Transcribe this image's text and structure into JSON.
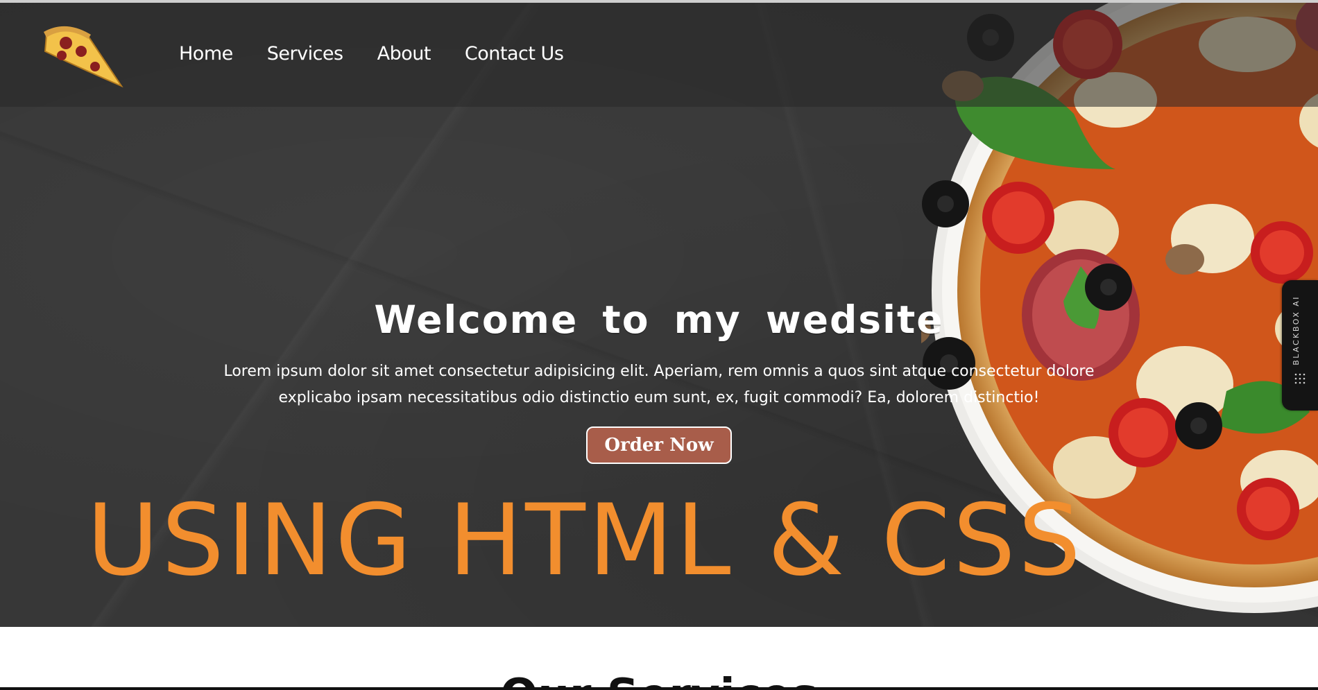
{
  "nav": {
    "items": [
      {
        "label": "Home"
      },
      {
        "label": "Services"
      },
      {
        "label": "About"
      },
      {
        "label": "Contact Us"
      }
    ]
  },
  "hero": {
    "title": "Welcome to my wedsite",
    "text": "Lorem ipsum dolor sit amet consectetur adipisicing elit. Aperiam, rem omnis a quos sint atque consectetur dolore explicabo ipsam necessitatibus odio distinctio eum sunt, ex, fugit commodi? Ea, dolorem distinctio!",
    "button": "Order Now",
    "banner": "USING HTML & CSS"
  },
  "sidebar_widget": {
    "label": "BLACKBOX AI"
  },
  "services": {
    "heading": "Our Services"
  },
  "colors": {
    "hero_bg": "#373737",
    "button_bg": "#a85d4a",
    "banner_text": "#f28e2e"
  },
  "icons": {
    "logo": "pizza-slice-icon",
    "widget": "dots-icon"
  }
}
